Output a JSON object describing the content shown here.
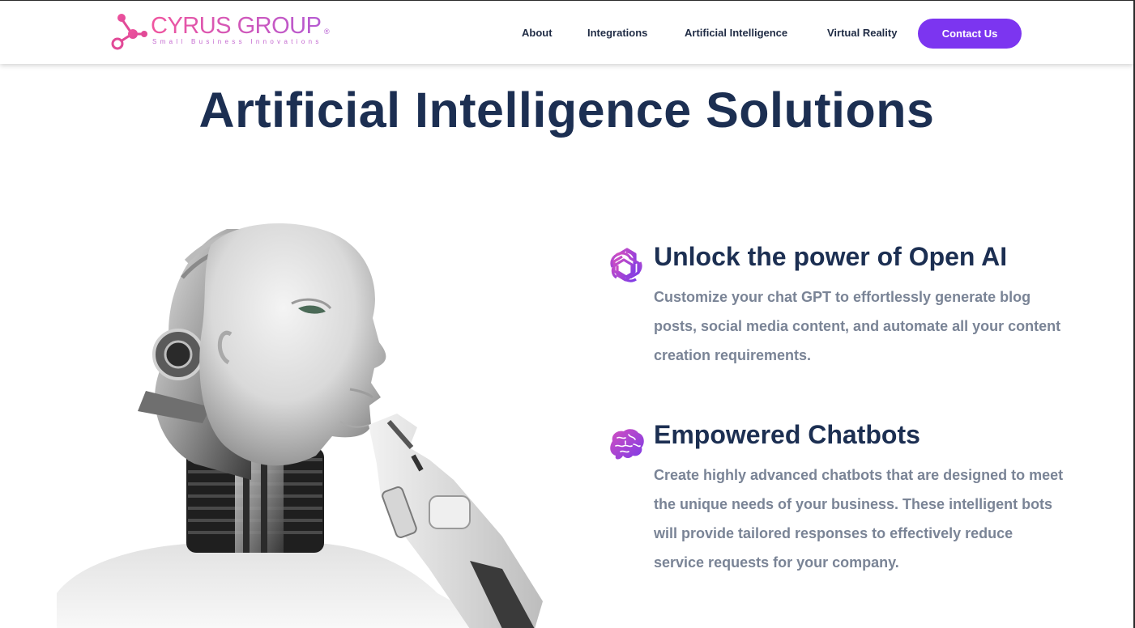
{
  "brand": {
    "name": "CYRUS GROUP",
    "registered_mark": "®",
    "tagline": "Small Business Innovations",
    "gradient_start": "#f0559e",
    "gradient_end": "#b55ad2"
  },
  "nav": {
    "items": [
      {
        "label": "About"
      },
      {
        "label": "Integrations"
      },
      {
        "label": "Artificial Intelligence"
      },
      {
        "label": "Virtual Reality"
      }
    ],
    "cta_label": "Contact Us",
    "cta_color": "#7c35f0"
  },
  "hero": {
    "title": "Artificial Intelligence Solutions",
    "title_color": "#1c2f52",
    "image_icon": "robot-thinking-illustration"
  },
  "features": [
    {
      "icon": "openai-icon",
      "title": "Unlock the power of Open AI",
      "description": "Customize your chat GPT to effortlessly generate blog posts, social media content, and automate all your content creation requirements."
    },
    {
      "icon": "brain-icon",
      "title": "Empowered Chatbots",
      "description": "Create highly advanced chatbots that are designed to meet the unique needs of your business. These intelligent bots will provide tailored responses to effectively reduce service requests for your company."
    }
  ],
  "colors": {
    "text_primary": "#1c2f52",
    "text_secondary": "#7a8496",
    "icon_gradient_start": "#d24fc0",
    "icon_gradient_end": "#7d3be6"
  }
}
